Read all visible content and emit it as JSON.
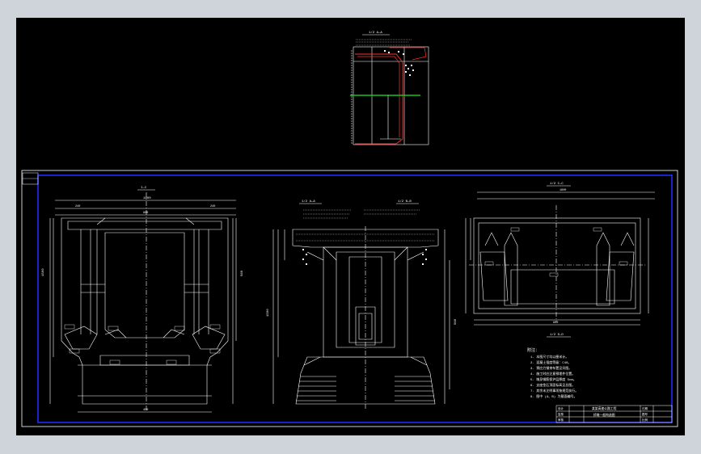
{
  "app": {
    "viewport": "model-space",
    "background": "#000000",
    "chrome": "#cfd3da"
  },
  "drawing": {
    "plan_view_title": "1/2 平面 1/2 立面",
    "section_a_label": "1/2 A—A",
    "section_b_label": "1/2 B—B",
    "top_view_label": "1/2 C—C",
    "bottom_view_label": "1/2 D—D",
    "plan_label": "I—I",
    "elev_label_left": "1/2 立面",
    "dims": {
      "w_total": "1800",
      "w_mid": "900",
      "h_total": "1500",
      "d1": "120",
      "d2": "300",
      "d3": "560",
      "d4": "240",
      "d5": "150",
      "d6": "80",
      "d7": "450"
    }
  },
  "notes": {
    "heading": "附注：",
    "lines": [
      "1. 本图尺寸均以厘米计。",
      "2. 混凝土强度等级：C40。",
      "3. 预应力钢束布置见另图。",
      "4. 施工时应注意预埋件位置。",
      "5. 墩身钢筋保护层厚度 5cm。",
      "6. 支座垫石顶面标高见总图。",
      "7. 其余未注明事项按规范执行。",
      "8. 图中 (A、B) 为截面编号。"
    ]
  },
  "title_block": {
    "project": "某某高速公路工程",
    "drawing_name": "桥墩一般构造图",
    "designer": "设计",
    "checker": "复核",
    "approver": "审核",
    "date": "日期",
    "sheet_no": "图号",
    "scale_value": "比例"
  },
  "colors": {
    "line": "#ffffff",
    "frame": "#1f2cff",
    "green_line": "#19c41f",
    "red_line": "#ff3030",
    "dim": "#ffffff"
  }
}
